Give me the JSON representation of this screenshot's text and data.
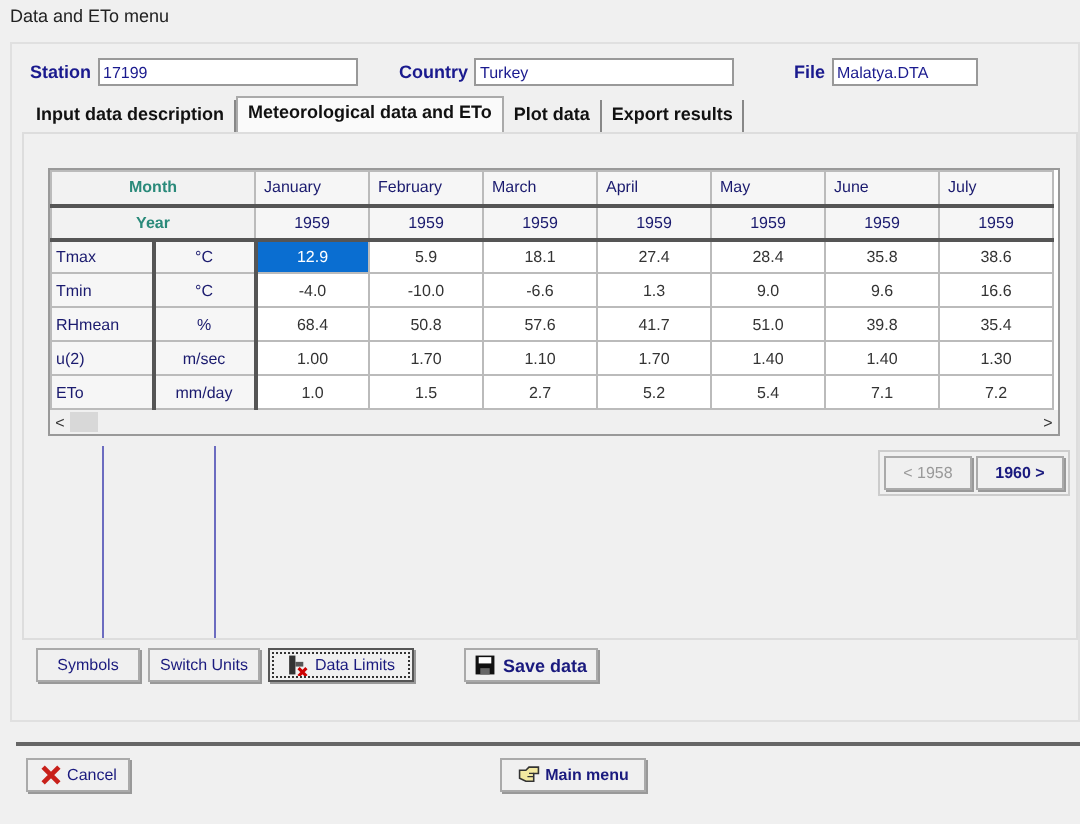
{
  "window": {
    "title": "Data and ETo menu"
  },
  "fields": [
    {
      "label": "Station",
      "value": "17199"
    },
    {
      "label": "Country",
      "value": "Turkey"
    },
    {
      "label": "File",
      "value": "Malatya.DTA"
    }
  ],
  "tabs": [
    {
      "label": "Input data description",
      "selected": false
    },
    {
      "label": "Meteorological data and ETo",
      "selected": true
    },
    {
      "label": "Plot data",
      "selected": false
    },
    {
      "label": "Export results",
      "selected": false
    }
  ],
  "table": {
    "header_rows": [
      {
        "label": "Month",
        "cells": [
          "January",
          "February",
          "March",
          "April",
          "May",
          "June",
          "July"
        ]
      },
      {
        "label": "Year",
        "cells": [
          "1959",
          "1959",
          "1959",
          "1959",
          "1959",
          "1959",
          "1959"
        ]
      }
    ],
    "rows": [
      {
        "name": "Tmax",
        "unit": "°C",
        "cells": [
          {
            "value": "12.9",
            "selected": true
          },
          {
            "value": "5.9",
            "selected": false
          },
          {
            "value": "18.1",
            "selected": false
          },
          {
            "value": "27.4",
            "selected": false
          },
          {
            "value": "28.4",
            "selected": false
          },
          {
            "value": "35.8",
            "selected": false
          },
          {
            "value": "38.6",
            "selected": false
          }
        ]
      },
      {
        "name": "Tmin",
        "unit": "°C",
        "cells": [
          {
            "value": "-4.0",
            "selected": false
          },
          {
            "value": "-10.0",
            "selected": false
          },
          {
            "value": "-6.6",
            "selected": false
          },
          {
            "value": "1.3",
            "selected": false
          },
          {
            "value": "9.0",
            "selected": false
          },
          {
            "value": "9.6",
            "selected": false
          },
          {
            "value": "16.6",
            "selected": false
          }
        ]
      },
      {
        "name": "RHmean",
        "unit": "%",
        "cells": [
          {
            "value": "68.4",
            "selected": false
          },
          {
            "value": "50.8",
            "selected": false
          },
          {
            "value": "57.6",
            "selected": false
          },
          {
            "value": "41.7",
            "selected": false
          },
          {
            "value": "51.0",
            "selected": false
          },
          {
            "value": "39.8",
            "selected": false
          },
          {
            "value": "35.4",
            "selected": false
          }
        ]
      },
      {
        "name": "u(2)",
        "unit": "m/sec",
        "cells": [
          {
            "value": "1.00",
            "selected": false
          },
          {
            "value": "1.70",
            "selected": false
          },
          {
            "value": "1.10",
            "selected": false
          },
          {
            "value": "1.70",
            "selected": false
          },
          {
            "value": "1.40",
            "selected": false
          },
          {
            "value": "1.40",
            "selected": false
          },
          {
            "value": "1.30",
            "selected": false
          }
        ]
      },
      {
        "name": "ETo",
        "unit": "mm/day",
        "cells": [
          {
            "value": "1.0",
            "selected": false
          },
          {
            "value": "1.5",
            "selected": false
          },
          {
            "value": "2.7",
            "selected": false
          },
          {
            "value": "5.2",
            "selected": false
          },
          {
            "value": "5.4",
            "selected": false
          },
          {
            "value": "7.1",
            "selected": false
          },
          {
            "value": "7.2",
            "selected": false
          }
        ]
      }
    ]
  },
  "scroll_arrows": [
    "<",
    ">"
  ],
  "year_nav": [
    {
      "label": "< 1958",
      "disabled": true
    },
    {
      "label": "1960 >",
      "disabled": false
    }
  ],
  "buttons": [
    {
      "label": "Symbols",
      "kind": "plain",
      "focused": false
    },
    {
      "label": "Switch Units",
      "kind": "plain",
      "focused": false
    },
    {
      "label": "Data Limits",
      "kind": "limits",
      "focused": true
    },
    {
      "label": "Save data",
      "kind": "save",
      "focused": false
    }
  ],
  "footer": [
    {
      "label": "Cancel",
      "kind": "cancel"
    },
    {
      "label": "Main menu",
      "kind": "menu"
    }
  ]
}
